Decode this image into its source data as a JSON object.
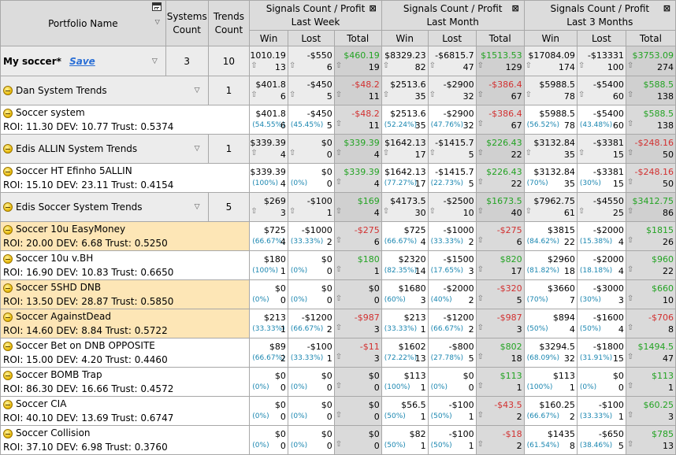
{
  "header": {
    "portfolio_name": "Portfolio Name",
    "systems_count": "Systems Count",
    "trends_count": "Trends Count",
    "group_caption": "Signals Count / Profit",
    "groups": [
      "Last Week",
      "Last Month",
      "Last 3 Months"
    ],
    "subcols": [
      "Win",
      "Lost",
      "Total"
    ]
  },
  "portfolio": {
    "name": "My soccer*",
    "save_label": "Save",
    "systems": "3",
    "trends": "10",
    "cells": [
      {
        "c": "13",
        "p": "$1010.19"
      },
      {
        "c": "6",
        "p": "-$550"
      },
      {
        "c": "19",
        "p": "$460.19",
        "s": "pos"
      },
      {
        "c": "82",
        "p": "$8329.23"
      },
      {
        "c": "47",
        "p": "-$6815.7"
      },
      {
        "c": "129",
        "p": "$1513.53",
        "s": "pos"
      },
      {
        "c": "174",
        "p": "$17084.09"
      },
      {
        "c": "100",
        "p": "-$13331"
      },
      {
        "c": "274",
        "p": "$3753.09",
        "s": "pos"
      }
    ]
  },
  "rows": [
    {
      "type": "group",
      "name": "Dan System Trends",
      "trends": "1",
      "cells": [
        {
          "c": "6",
          "p": "$401.8"
        },
        {
          "c": "5",
          "p": "-$450"
        },
        {
          "c": "11",
          "p": "-$48.2",
          "s": "neg"
        },
        {
          "c": "35",
          "p": "$2513.6"
        },
        {
          "c": "32",
          "p": "-$2900"
        },
        {
          "c": "67",
          "p": "-$386.4",
          "s": "neg"
        },
        {
          "c": "78",
          "p": "$5988.5"
        },
        {
          "c": "60",
          "p": "-$5400"
        },
        {
          "c": "138",
          "p": "$588.5",
          "s": "pos"
        }
      ]
    },
    {
      "type": "sys",
      "hl": false,
      "name": "Soccer system",
      "roi": "ROI: 11.30 DEV: 10.77 Trust: 0.5374",
      "cells": [
        {
          "pct": "(54.55%)",
          "c": "6",
          "p": "$401.8"
        },
        {
          "pct": "(45.45%)",
          "c": "5",
          "p": "-$450"
        },
        {
          "c": "11",
          "p": "-$48.2",
          "s": "neg"
        },
        {
          "pct": "(52.24%)",
          "c": "35",
          "p": "$2513.6"
        },
        {
          "pct": "(47.76%)",
          "c": "32",
          "p": "-$2900"
        },
        {
          "c": "67",
          "p": "-$386.4",
          "s": "neg"
        },
        {
          "pct": "(56.52%)",
          "c": "78",
          "p": "$5988.5"
        },
        {
          "pct": "(43.48%)",
          "c": "60",
          "p": "-$5400"
        },
        {
          "c": "138",
          "p": "$588.5",
          "s": "pos"
        }
      ]
    },
    {
      "type": "group",
      "name": "Edis ALLIN System Trends",
      "trends": "1",
      "cells": [
        {
          "c": "4",
          "p": "$339.39"
        },
        {
          "c": "0",
          "p": "$0"
        },
        {
          "c": "4",
          "p": "$339.39",
          "s": "pos"
        },
        {
          "c": "17",
          "p": "$1642.13"
        },
        {
          "c": "5",
          "p": "-$1415.7"
        },
        {
          "c": "22",
          "p": "$226.43",
          "s": "pos"
        },
        {
          "c": "35",
          "p": "$3132.84"
        },
        {
          "c": "15",
          "p": "-$3381"
        },
        {
          "c": "50",
          "p": "-$248.16",
          "s": "neg"
        }
      ]
    },
    {
      "type": "sys",
      "hl": false,
      "name": "Soccer HT Efinho 5ALLIN",
      "roi": "ROI: 15.10 DEV: 23.11 Trust: 0.4154",
      "cells": [
        {
          "pct": "(100%)",
          "c": "4",
          "p": "$339.39"
        },
        {
          "pct": "(0%)",
          "c": "0",
          "p": "$0"
        },
        {
          "c": "4",
          "p": "$339.39",
          "s": "pos"
        },
        {
          "pct": "(77.27%)",
          "c": "17",
          "p": "$1642.13"
        },
        {
          "pct": "(22.73%)",
          "c": "5",
          "p": "-$1415.7"
        },
        {
          "c": "22",
          "p": "$226.43",
          "s": "pos"
        },
        {
          "pct": "(70%)",
          "c": "35",
          "p": "$3132.84"
        },
        {
          "pct": "(30%)",
          "c": "15",
          "p": "-$3381"
        },
        {
          "c": "50",
          "p": "-$248.16",
          "s": "neg"
        }
      ]
    },
    {
      "type": "group",
      "name": "Edis Soccer System Trends",
      "trends": "5",
      "cells": [
        {
          "c": "3",
          "p": "$269"
        },
        {
          "c": "1",
          "p": "-$100"
        },
        {
          "c": "4",
          "p": "$169",
          "s": "pos"
        },
        {
          "c": "30",
          "p": "$4173.5"
        },
        {
          "c": "10",
          "p": "-$2500"
        },
        {
          "c": "40",
          "p": "$1673.5",
          "s": "pos"
        },
        {
          "c": "61",
          "p": "$7962.75"
        },
        {
          "c": "25",
          "p": "-$4550"
        },
        {
          "c": "86",
          "p": "$3412.75",
          "s": "pos"
        }
      ]
    },
    {
      "type": "sys",
      "hl": true,
      "name": "Soccer 10u EasyMoney",
      "roi": "ROI: 20.00 DEV: 6.68 Trust: 0.5250",
      "cells": [
        {
          "pct": "(66.67%)",
          "c": "4",
          "p": "$725"
        },
        {
          "pct": "(33.33%)",
          "c": "2",
          "p": "-$1000"
        },
        {
          "c": "6",
          "p": "-$275",
          "s": "neg"
        },
        {
          "pct": "(66.67%)",
          "c": "4",
          "p": "$725"
        },
        {
          "pct": "(33.33%)",
          "c": "2",
          "p": "-$1000"
        },
        {
          "c": "6",
          "p": "-$275",
          "s": "neg"
        },
        {
          "pct": "(84.62%)",
          "c": "22",
          "p": "$3815"
        },
        {
          "pct": "(15.38%)",
          "c": "4",
          "p": "-$2000"
        },
        {
          "c": "26",
          "p": "$1815",
          "s": "pos"
        }
      ]
    },
    {
      "type": "sys",
      "hl": false,
      "name": "Soccer 10u v.BH",
      "roi": "ROI: 16.90 DEV: 10.83 Trust: 0.6650",
      "cells": [
        {
          "pct": "(100%)",
          "c": "1",
          "p": "$180"
        },
        {
          "pct": "(0%)",
          "c": "0",
          "p": "$0"
        },
        {
          "c": "1",
          "p": "$180",
          "s": "pos"
        },
        {
          "pct": "(82.35%)",
          "c": "14",
          "p": "$2320"
        },
        {
          "pct": "(17.65%)",
          "c": "3",
          "p": "-$1500"
        },
        {
          "c": "17",
          "p": "$820",
          "s": "pos"
        },
        {
          "pct": "(81.82%)",
          "c": "18",
          "p": "$2960"
        },
        {
          "pct": "(18.18%)",
          "c": "4",
          "p": "-$2000"
        },
        {
          "c": "22",
          "p": "$960",
          "s": "pos"
        }
      ]
    },
    {
      "type": "sys",
      "hl": true,
      "name": "Soccer 5SHD DNB",
      "roi": "ROI: 13.50 DEV: 28.87 Trust: 0.5850",
      "cells": [
        {
          "pct": "(0%)",
          "c": "0",
          "p": "$0"
        },
        {
          "pct": "(0%)",
          "c": "0",
          "p": "$0"
        },
        {
          "c": "0",
          "p": "$0",
          "s": "plain"
        },
        {
          "pct": "(60%)",
          "c": "3",
          "p": "$1680"
        },
        {
          "pct": "(40%)",
          "c": "2",
          "p": "-$2000"
        },
        {
          "c": "5",
          "p": "-$320",
          "s": "neg"
        },
        {
          "pct": "(70%)",
          "c": "7",
          "p": "$3660"
        },
        {
          "pct": "(30%)",
          "c": "3",
          "p": "-$3000"
        },
        {
          "c": "10",
          "p": "$660",
          "s": "pos"
        }
      ]
    },
    {
      "type": "sys",
      "hl": true,
      "name": "Soccer AgainstDead",
      "roi": "ROI: 14.60 DEV: 8.84 Trust: 0.5722",
      "cells": [
        {
          "pct": "(33.33%)",
          "c": "1",
          "p": "$213"
        },
        {
          "pct": "(66.67%)",
          "c": "2",
          "p": "-$1200"
        },
        {
          "c": "3",
          "p": "-$987",
          "s": "neg"
        },
        {
          "pct": "(33.33%)",
          "c": "1",
          "p": "$213"
        },
        {
          "pct": "(66.67%)",
          "c": "2",
          "p": "-$1200"
        },
        {
          "c": "3",
          "p": "-$987",
          "s": "neg"
        },
        {
          "pct": "(50%)",
          "c": "4",
          "p": "$894"
        },
        {
          "pct": "(50%)",
          "c": "4",
          "p": "-$1600"
        },
        {
          "c": "8",
          "p": "-$706",
          "s": "neg"
        }
      ]
    },
    {
      "type": "sys",
      "hl": false,
      "name": "Soccer Bet on DNB OPPOSITE",
      "roi": "ROI: 15.00 DEV: 4.20 Trust: 0.4460",
      "cells": [
        {
          "pct": "(66.67%)",
          "c": "2",
          "p": "$89"
        },
        {
          "pct": "(33.33%)",
          "c": "1",
          "p": "-$100"
        },
        {
          "c": "3",
          "p": "-$11",
          "s": "neg"
        },
        {
          "pct": "(72.22%)",
          "c": "13",
          "p": "$1602"
        },
        {
          "pct": "(27.78%)",
          "c": "5",
          "p": "-$800"
        },
        {
          "c": "18",
          "p": "$802",
          "s": "pos"
        },
        {
          "pct": "(68.09%)",
          "c": "32",
          "p": "$3294.5"
        },
        {
          "pct": "(31.91%)",
          "c": "15",
          "p": "-$1800"
        },
        {
          "c": "47",
          "p": "$1494.5",
          "s": "pos"
        }
      ]
    },
    {
      "type": "sys",
      "hl": false,
      "name": "Soccer BOMB Trap",
      "roi": "ROI: 86.30 DEV: 16.66 Trust: 0.4572",
      "cells": [
        {
          "pct": "(0%)",
          "c": "0",
          "p": "$0"
        },
        {
          "pct": "(0%)",
          "c": "0",
          "p": "$0"
        },
        {
          "c": "0",
          "p": "$0",
          "s": "plain"
        },
        {
          "pct": "(100%)",
          "c": "1",
          "p": "$113"
        },
        {
          "pct": "(0%)",
          "c": "0",
          "p": "$0"
        },
        {
          "c": "1",
          "p": "$113",
          "s": "pos"
        },
        {
          "pct": "(100%)",
          "c": "1",
          "p": "$113"
        },
        {
          "pct": "(0%)",
          "c": "0",
          "p": "$0"
        },
        {
          "c": "1",
          "p": "$113",
          "s": "pos"
        }
      ]
    },
    {
      "type": "sys",
      "hl": false,
      "name": "Soccer CIA",
      "roi": "ROI: 40.10 DEV: 13.69 Trust: 0.6747",
      "cells": [
        {
          "pct": "(0%)",
          "c": "0",
          "p": "$0"
        },
        {
          "pct": "(0%)",
          "c": "0",
          "p": "$0"
        },
        {
          "c": "0",
          "p": "$0",
          "s": "plain"
        },
        {
          "pct": "(50%)",
          "c": "1",
          "p": "$56.5"
        },
        {
          "pct": "(50%)",
          "c": "1",
          "p": "-$100"
        },
        {
          "c": "2",
          "p": "-$43.5",
          "s": "neg"
        },
        {
          "pct": "(66.67%)",
          "c": "2",
          "p": "$160.25"
        },
        {
          "pct": "(33.33%)",
          "c": "1",
          "p": "-$100"
        },
        {
          "c": "3",
          "p": "$60.25",
          "s": "pos"
        }
      ]
    },
    {
      "type": "sys",
      "hl": false,
      "name": "Soccer Collision",
      "roi": "ROI: 37.10 DEV: 6.98 Trust: 0.3760",
      "cells": [
        {
          "pct": "(0%)",
          "c": "0",
          "p": "$0"
        },
        {
          "pct": "(0%)",
          "c": "0",
          "p": "$0"
        },
        {
          "c": "0",
          "p": "$0",
          "s": "plain"
        },
        {
          "pct": "(50%)",
          "c": "1",
          "p": "$82"
        },
        {
          "pct": "(50%)",
          "c": "1",
          "p": "-$100"
        },
        {
          "c": "2",
          "p": "-$18",
          "s": "neg"
        },
        {
          "pct": "(61.54%)",
          "c": "8",
          "p": "$1435"
        },
        {
          "pct": "(38.46%)",
          "c": "5",
          "p": "-$650"
        },
        {
          "c": "13",
          "p": "$785",
          "s": "pos"
        }
      ]
    }
  ]
}
